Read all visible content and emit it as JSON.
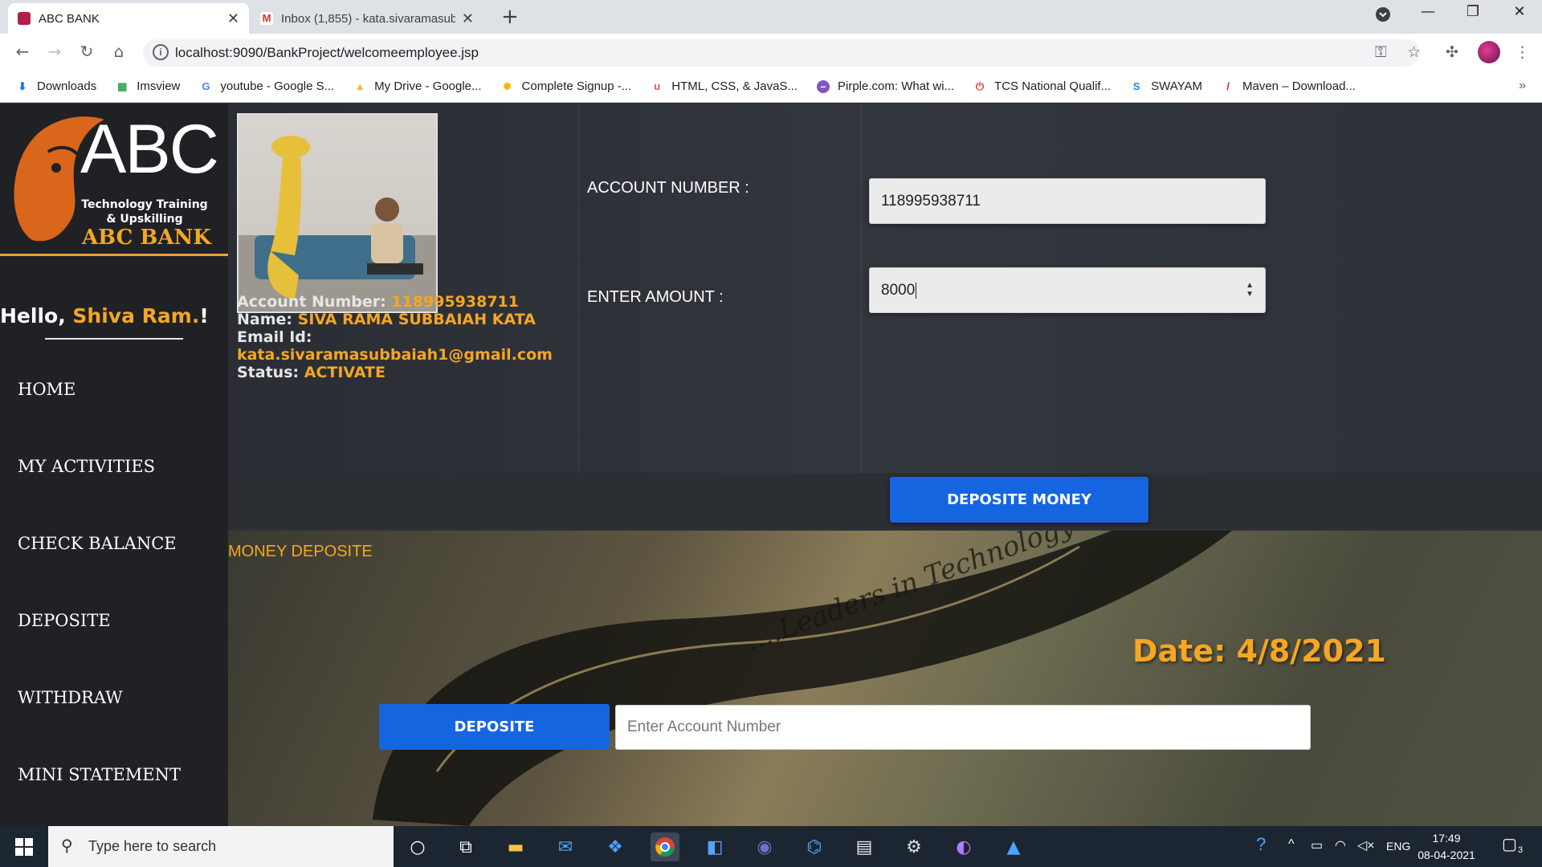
{
  "browser": {
    "tabs": [
      {
        "title": "ABC BANK",
        "active": true
      },
      {
        "title": "Inbox (1,855) - kata.sivaramasubb",
        "active": false
      }
    ],
    "url": "localhost:9090/BankProject/welcomeemployee.jsp",
    "bookmarks": [
      {
        "label": "Downloads",
        "icon": "download-icon"
      },
      {
        "label": "Imsview",
        "icon": "grid-icon"
      },
      {
        "label": "youtube - Google S...",
        "icon": "google-icon"
      },
      {
        "label": "My Drive - Google...",
        "icon": "drive-icon"
      },
      {
        "label": "Complete Signup -...",
        "icon": "sun-icon"
      },
      {
        "label": "HTML, CSS, & JavaS...",
        "icon": "udemy-icon"
      },
      {
        "label": "Pirple.com: What wi...",
        "icon": "pirple-icon"
      },
      {
        "label": "TCS National Qualif...",
        "icon": "tcs-icon"
      },
      {
        "label": "SWAYAM",
        "icon": "swayam-icon"
      },
      {
        "label": "Maven – Download...",
        "icon": "maven-icon"
      }
    ]
  },
  "sidebar": {
    "logo": {
      "big": "ABC",
      "line1": "Technology Training",
      "line2": "& Upskilling",
      "bank": "ABC BANK"
    },
    "greeting_prefix": "Hello,",
    "greeting_name": "Shiva Ram.",
    "greeting_suffix": "!",
    "menu": [
      "HOME",
      "MY ACTIVITIES",
      "CHECK BALANCE",
      "DEPOSITE",
      "WITHDRAW",
      "MINI STATEMENT"
    ]
  },
  "profile": {
    "account_label": "Account Number:",
    "account_value": "118995938711",
    "name_label": "Name:",
    "name_value": "SIVA RAMA SUBBAIAH KATA",
    "email_label": "Email Id:",
    "email_value": "kata.sivaramasubbaiah1@gmail.com",
    "status_label": "Status:",
    "status_value": "ACTIVATE"
  },
  "form": {
    "account_label": "ACCOUNT NUMBER :",
    "account_value": "118995938711",
    "amount_label": "ENTER AMOUNT :",
    "amount_value": "8000",
    "submit_label": "DEPOSITE MONEY"
  },
  "banner": {
    "title": "MONEY DEPOSITE",
    "watermark": "....Leaders in Technology Training",
    "date": "Date: 4/8/2021",
    "deposite_button": "DEPOSITE",
    "account_placeholder": "Enter Account Number"
  },
  "taskbar": {
    "search_placeholder": "Type here to search",
    "language": "ENG",
    "time": "17:49",
    "date": "08-04-2021",
    "notification_count": "3"
  },
  "colors": {
    "accent_orange": "#f5a623",
    "button_blue": "#1565e0",
    "sidebar_bg": "#1f2125"
  }
}
